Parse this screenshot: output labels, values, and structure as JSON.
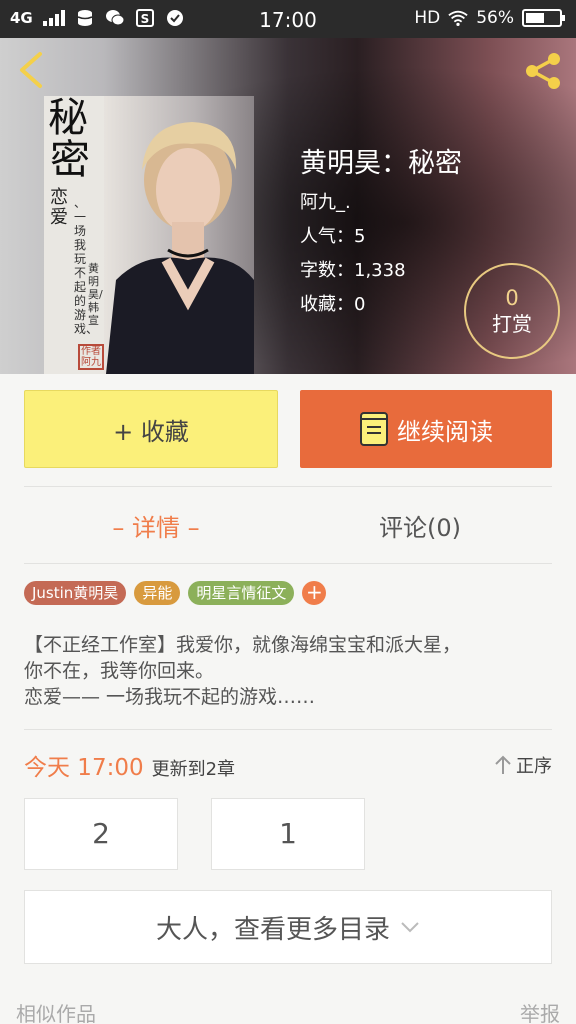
{
  "status_bar": {
    "network": "4G",
    "time": "17:00",
    "hd": "HD",
    "battery_text": "56%",
    "battery_level": 0.56
  },
  "book": {
    "title": "黄明昊：秘密",
    "author": "阿九_.",
    "popularity": "人气：5",
    "word_count": "字数：1,338",
    "favorites": "收藏：0"
  },
  "cover": {
    "title_line1": "秘",
    "title_line2": "密",
    "subtitle": "恋爱",
    "vertical_text_1": "、一场我玩不起的游戏、",
    "vertical_text_2": "黄明昊/韩宣",
    "stamp": "作者阿九"
  },
  "tip": {
    "count": "0",
    "label": "打赏"
  },
  "actions": {
    "favorite_label": "+ 收藏",
    "continue_label": "继续阅读"
  },
  "tabs": {
    "detail": "– 详情 –",
    "comment": "评论(0)"
  },
  "tags": [
    {
      "label": "Justin黄明昊",
      "color": "#c46a55"
    },
    {
      "label": "异能",
      "color": "#d89a3e"
    },
    {
      "label": "明星言情征文",
      "color": "#8cb05a"
    }
  ],
  "tag_add": "+",
  "description": {
    "line1": "【不正经工作室】我爱你，就像海绵宝宝和派大星，",
    "line2": "你不在，我等你回来。",
    "line3": "恋爱—— 一场我玩不起的游戏……"
  },
  "update": {
    "time": "今天 17:00",
    "text": "更新到2章"
  },
  "sort_label": "正序",
  "chapters": [
    "2",
    "1"
  ],
  "more_catalog": "大人，查看更多目录",
  "footer": {
    "left": "相似作品",
    "right": "举报"
  },
  "colors": {
    "accent": "#f07d4a",
    "read_button": "#e86b3c",
    "favorite_button": "#fbf07a"
  }
}
